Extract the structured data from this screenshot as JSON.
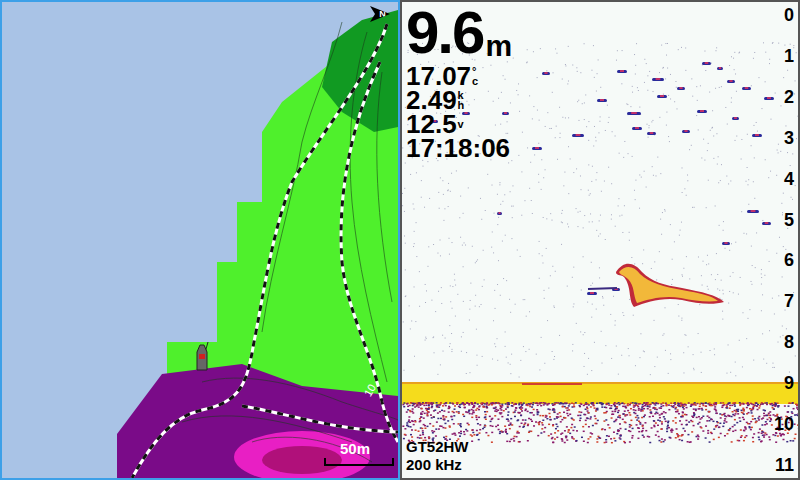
{
  "map": {
    "north": "N",
    "scale": "50m",
    "contour_label": "10"
  },
  "sonar": {
    "depth": {
      "value": "9.6",
      "unit": "m"
    },
    "readings": [
      {
        "value": "17.07",
        "unit": [
          "°",
          "c"
        ]
      },
      {
        "value": "2.49",
        "unit": [
          "k",
          "h"
        ]
      },
      {
        "value": "12.5",
        "unit": [
          "v"
        ]
      },
      {
        "value": "17:18:06",
        "unit": []
      }
    ],
    "depth_scale": [
      "0",
      "1",
      "2",
      "3",
      "4",
      "5",
      "6",
      "7",
      "8",
      "9",
      "10",
      "11"
    ],
    "transducer": "GT52HW",
    "frequency": "200 kHz"
  }
}
